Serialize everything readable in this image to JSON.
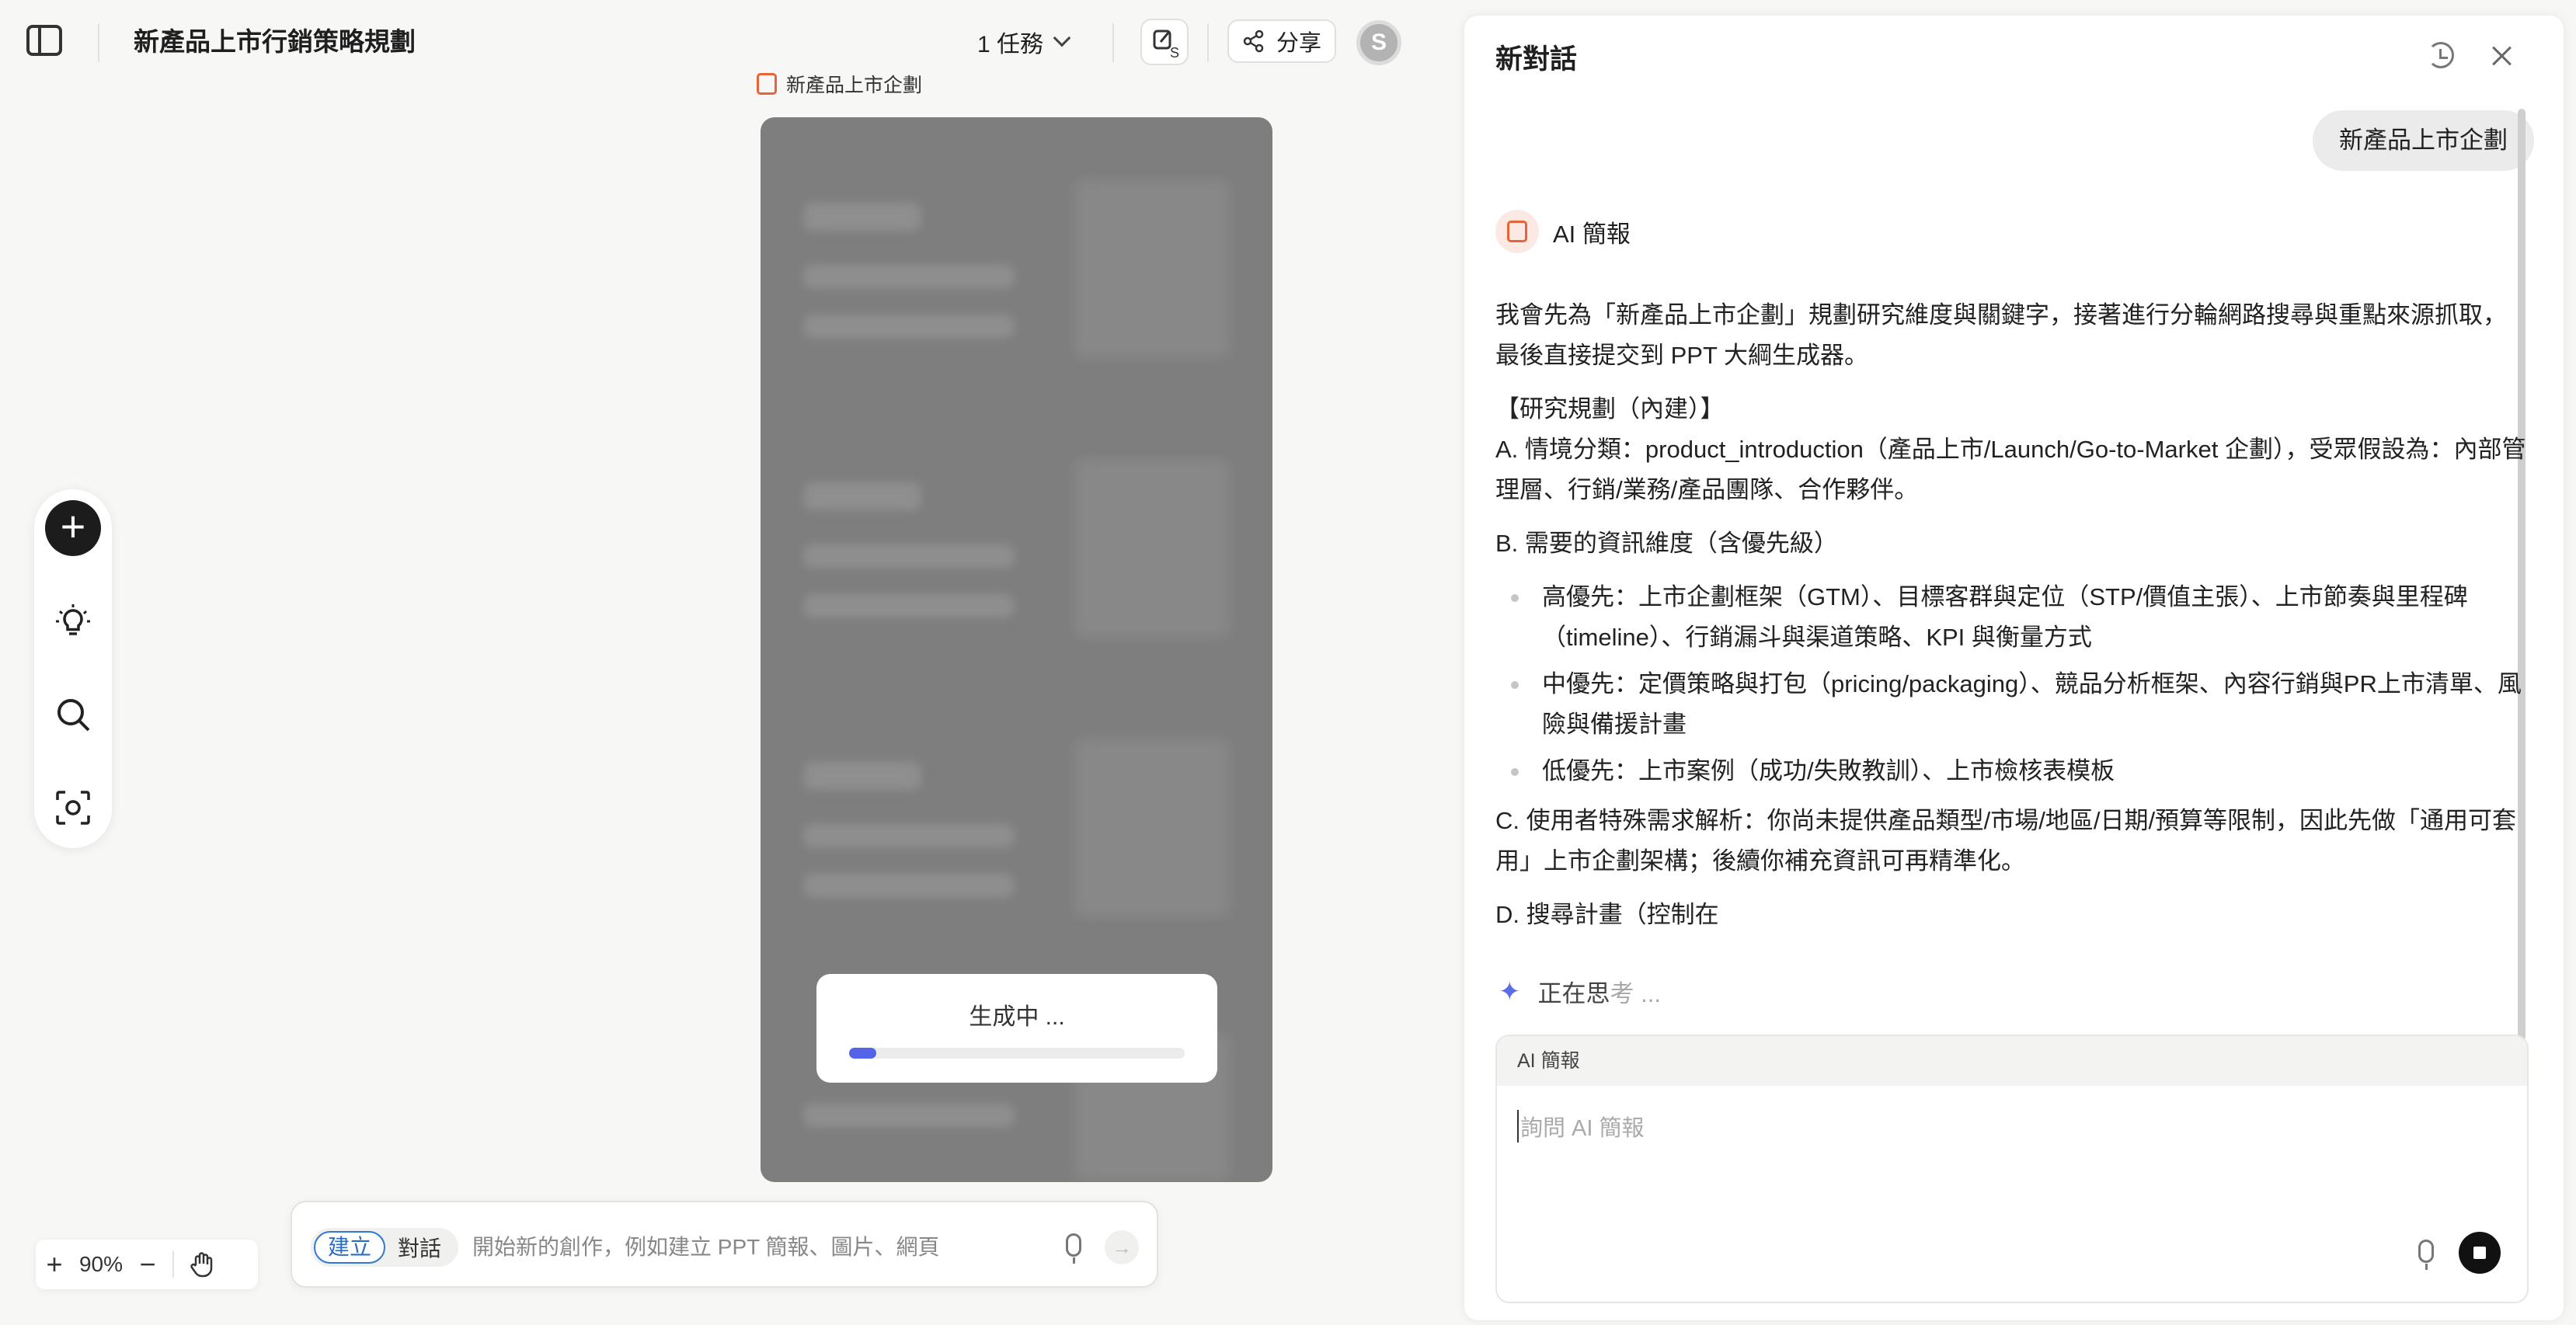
{
  "header": {
    "document_title": "新產品上市行銷策略規劃",
    "task_label": "1 任務",
    "share_label": "分享",
    "avatar_letter": "S"
  },
  "canvas": {
    "slide_label": "新產品上市企劃",
    "generating_text": "生成中 ...",
    "progress": 0.08,
    "zoom_level": "90%"
  },
  "toolbar": {
    "tools": [
      "add-icon",
      "lightbulb-icon",
      "search-icon",
      "scan-icon"
    ]
  },
  "canvas_input": {
    "mode_create": "建立",
    "mode_chat": "對話",
    "placeholder": "開始新的創作，例如建立 PPT 簡報、圖片、網頁"
  },
  "chat": {
    "title": "新對話",
    "user_message": "新產品上市企劃",
    "assistant_name": "AI 簡報",
    "paragraphs": [
      "我會先為「新產品上市企劃」規劃研究維度與關鍵字，接著進行分輪網路搜尋與重點來源抓取，最後直接提交到 PPT 大綱生成器。",
      "【研究規劃（內建）】",
      "A. 情境分類：product_introduction（產品上市/Launch/Go-to-Market 企劃），受眾假設為：內部管理層、行銷/業務/產品團隊、合作夥伴。",
      "B. 需要的資訊維度（含優先級）"
    ],
    "bullets": [
      "高優先：上市企劃框架（GTM）、目標客群與定位（STP/價值主張）、上市節奏與里程碑（timeline）、行銷漏斗與渠道策略、KPI 與衡量方式",
      "中優先：定價策略與打包（pricing/packaging）、競品分析框架、內容行銷與PR上市清單、風險與備援計畫",
      "低優先：上市案例（成功/失敗教訓）、上市檢核表模板"
    ],
    "paragraphs_after": [
      "C. 使用者特殊需求解析：你尚未提供產品類型/市場/地區/日期/預算等限制，因此先做「通用可套用」上市企劃架構；後續你補充資訊可再精準化。",
      "D. 搜尋計畫（控制在"
    ],
    "thinking_main": "正在思",
    "thinking_fade": "考 ...",
    "input_header": "AI 簡報",
    "input_placeholder": "詢問 AI 簡報"
  }
}
